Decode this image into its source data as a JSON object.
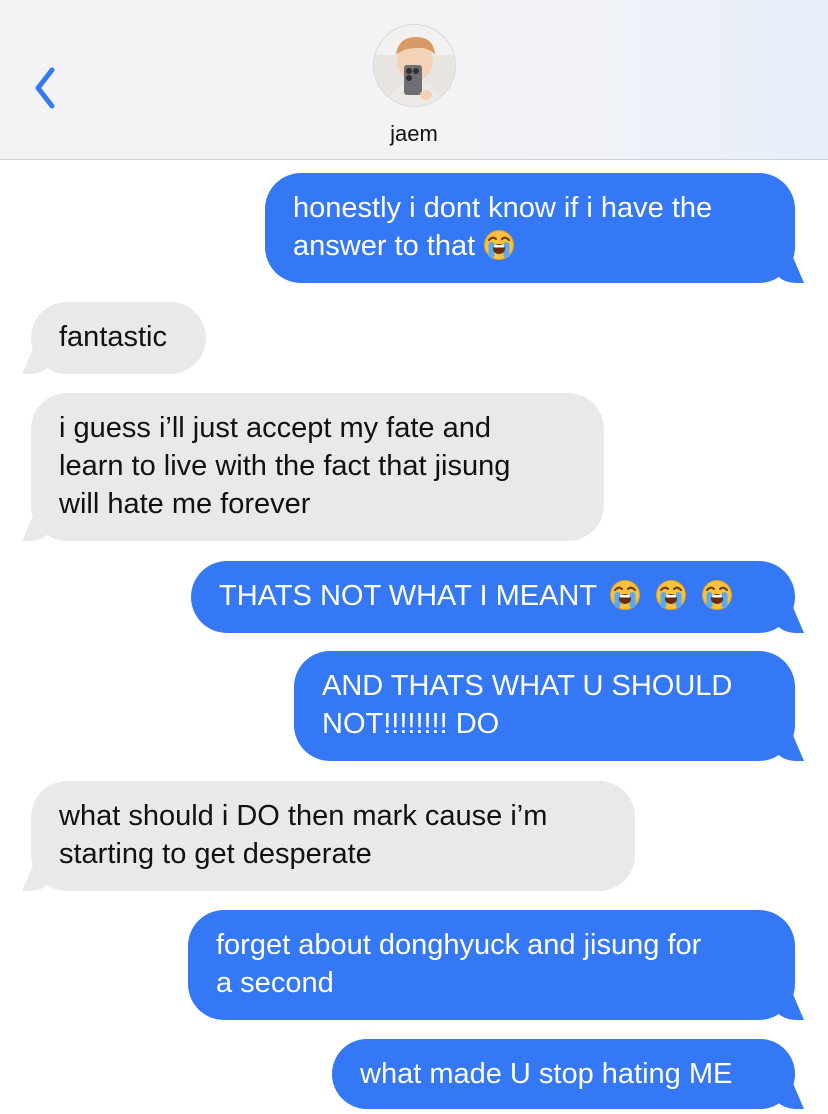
{
  "contact": {
    "name": "jaem"
  },
  "messages": [
    {
      "from": "me",
      "line1": "honestly i dont know if i have the",
      "line2": "answer to that",
      "emoji_count": 1
    },
    {
      "from": "them",
      "line1": "fantastic"
    },
    {
      "from": "them",
      "line1": "i guess i’ll just accept my fate and",
      "line2": "learn to live with the fact that jisung",
      "line3": "will hate me forever"
    },
    {
      "from": "me",
      "line1": "THATS NOT WHAT I MEANT",
      "emoji_count": 3
    },
    {
      "from": "me",
      "line1": "AND THATS WHAT U SHOULD",
      "line2": "NOT!!!!!!!! DO"
    },
    {
      "from": "them",
      "line1": "what should i DO then mark cause i’m",
      "line2": "starting to get desperate"
    },
    {
      "from": "me",
      "line1": "forget about donghyuck and jisung for",
      "line2": "a second"
    },
    {
      "from": "me",
      "line1": "what made U stop hating ME"
    }
  ],
  "icons": {
    "back": "chevron-left-icon",
    "emoji": "loudly-crying-face-icon"
  },
  "colors": {
    "sent_bubble": "#3478f6",
    "received_bubble": "#e9e9eb",
    "accent": "#3478f6"
  }
}
